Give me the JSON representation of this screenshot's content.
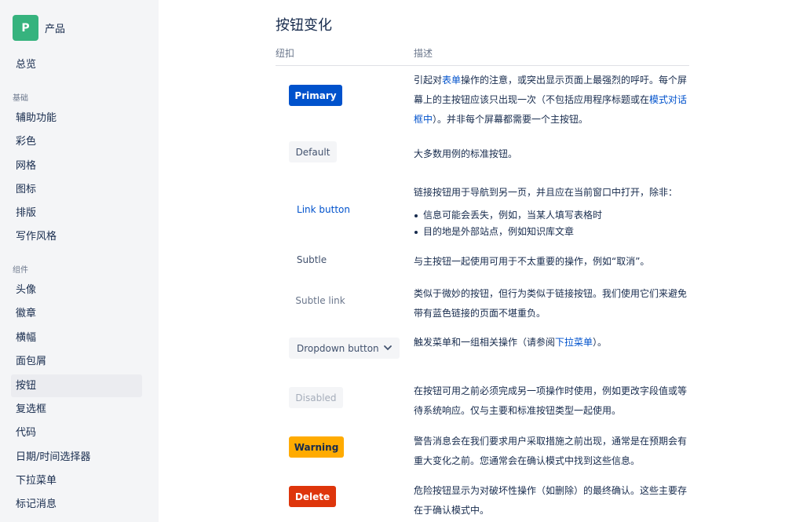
{
  "sidebar": {
    "logo_letter": "P",
    "brand": "产品",
    "overview": "总览",
    "section_basics": "基础",
    "basics": [
      "辅助功能",
      "彩色",
      "网格",
      "图标",
      "排版",
      "写作风格"
    ],
    "section_components": "组件",
    "components": [
      "头像",
      "徽章",
      "横幅",
      "面包屑",
      "按钮",
      "复选框",
      "代码",
      "日期/时间选择器",
      "下拉菜单",
      "标记消息"
    ],
    "active_item": "按钮"
  },
  "main": {
    "title": "按钮变化",
    "col_button": "纽扣",
    "col_desc": "描述",
    "rows": {
      "primary": {
        "button": "Primary",
        "d1": "引起对",
        "d1_link": "表单",
        "d2": "操作的注意，或突出显示页面上最强烈的呼吁。每个屏幕上的主按钮应该只出现一次（不包括应用程序标题或在",
        "d2_link": "模式对话框中",
        "d3": "）。并非每个屏幕都需要一个主按钮。"
      },
      "default": {
        "button": "Default",
        "desc": "大多数用例的标准按钮。"
      },
      "link": {
        "button": "Link button",
        "desc": "链接按钮用于导航到另一页，并且应在当前窗口中打开，除非：",
        "bullets": [
          "信息可能会丢失，例如，当某人填写表格时",
          "目的地是外部站点，例如知识库文章"
        ]
      },
      "subtle": {
        "button": "Subtle",
        "desc": "与主按钮一起使用可用于不太重要的操作，例如“取消”。"
      },
      "subtle_link": {
        "button": "Subtle link",
        "desc": "类似于微妙的按钮，但行为类似于链接按钮。我们使用它们来避免带有蓝色链接的页面不堪重负。"
      },
      "dropdown": {
        "button": "Dropdown button",
        "d1": "触发菜单和一组相关操作（请参阅",
        "d1_link": "下拉菜单",
        "d2": "）。"
      },
      "disabled": {
        "button": "Disabled",
        "desc": "在按钮可用之前必须完成另一项操作时使用，例如更改字段值或等待系统响应。仅与主要和标准按钮类型一起使用。"
      },
      "warning": {
        "button": "Warning",
        "desc": "警告消息会在我们要求用户采取措施之前出现，通常是在预期会有重大变化之前。您通常会在确认模式中找到这些信息。"
      },
      "delete": {
        "button": "Delete",
        "desc": "危险按钮显示为对破坏性操作（如删除）的最终确认。这些主要存在于确认模式中。"
      }
    }
  },
  "icons": {
    "dropdown": "chevron-down-icon"
  },
  "colors": {
    "primary": "#0052cc",
    "warning": "#ffab00",
    "danger": "#de350b",
    "brand": "#36b37e"
  }
}
